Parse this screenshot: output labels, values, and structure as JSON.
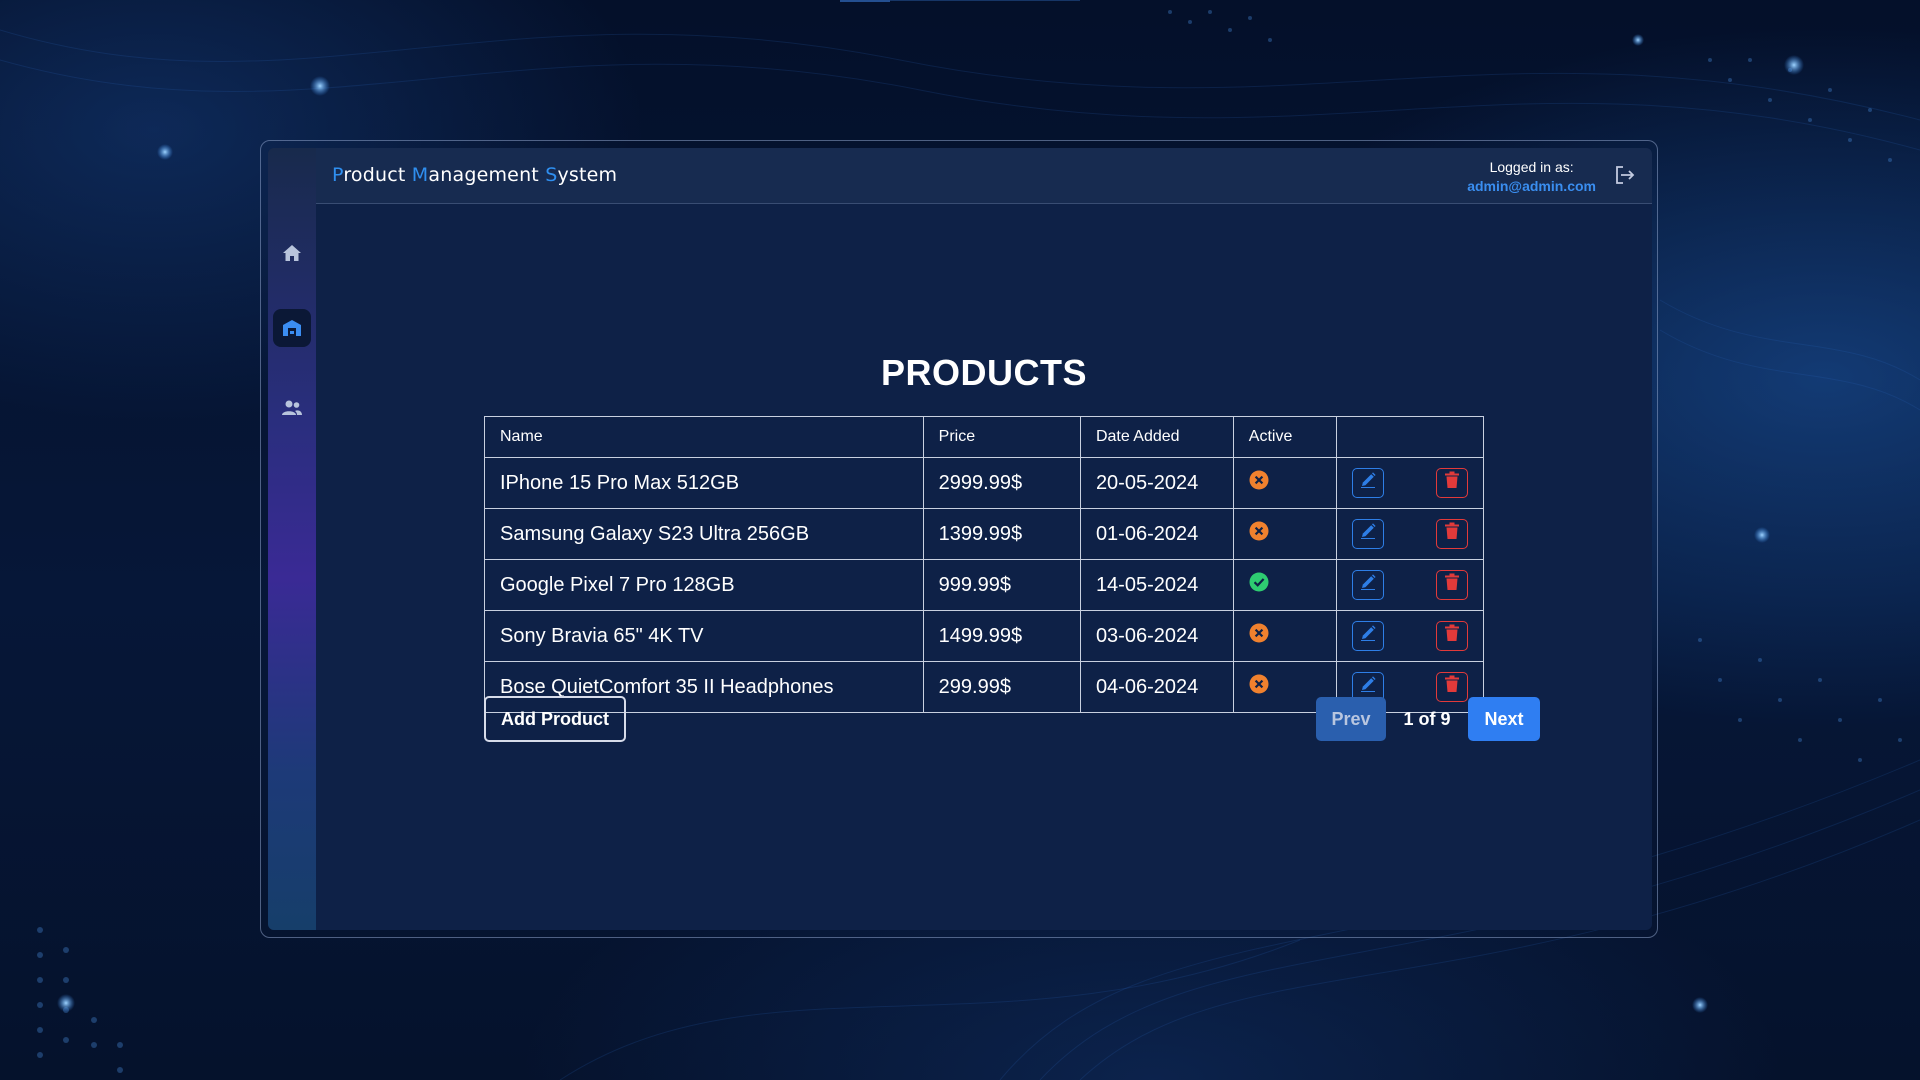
{
  "app": {
    "title_parts": [
      {
        "text": "P",
        "accent": true
      },
      {
        "text": "roduct ",
        "accent": false
      },
      {
        "text": "M",
        "accent": true
      },
      {
        "text": "anagement ",
        "accent": false
      },
      {
        "text": "S",
        "accent": true
      },
      {
        "text": "ystem",
        "accent": false
      }
    ],
    "accent_color": "#2f8ff0"
  },
  "user": {
    "caption": "Logged in as:",
    "email": "admin@admin.com",
    "logout_icon": "logout-icon"
  },
  "sidebar": {
    "items": [
      {
        "name": "home",
        "icon": "home-icon",
        "active": false
      },
      {
        "name": "products",
        "icon": "store-icon",
        "active": true
      },
      {
        "name": "users",
        "icon": "users-icon",
        "active": false
      }
    ]
  },
  "page": {
    "title": "PRODUCTS"
  },
  "table": {
    "columns": [
      "Name",
      "Price",
      "Date Added",
      "Active",
      ""
    ],
    "rows": [
      {
        "name": "IPhone 15 Pro Max 512GB",
        "price": "2999.99$",
        "date": "20-05-2024",
        "active": false
      },
      {
        "name": "Samsung Galaxy S23 Ultra 256GB",
        "price": "1399.99$",
        "date": "01-06-2024",
        "active": false
      },
      {
        "name": "Google Pixel 7 Pro 128GB",
        "price": "999.99$",
        "date": "14-05-2024",
        "active": true
      },
      {
        "name": "Sony Bravia 65\" 4K TV",
        "price": "1499.99$",
        "date": "03-06-2024",
        "active": false
      },
      {
        "name": "Bose QuietComfort 35 II Headphones",
        "price": "299.99$",
        "date": "04-06-2024",
        "active": false
      }
    ],
    "status_colors": {
      "active": "#2ecc71",
      "inactive": "#f0812e"
    },
    "row_actions": {
      "edit_icon": "pencil-icon",
      "delete_icon": "trash-icon"
    }
  },
  "actions": {
    "add_label": "Add Product"
  },
  "pagination": {
    "prev_label": "Prev",
    "next_label": "Next",
    "current_page": 1,
    "total_pages": 9,
    "indicator": "1 of 9"
  }
}
